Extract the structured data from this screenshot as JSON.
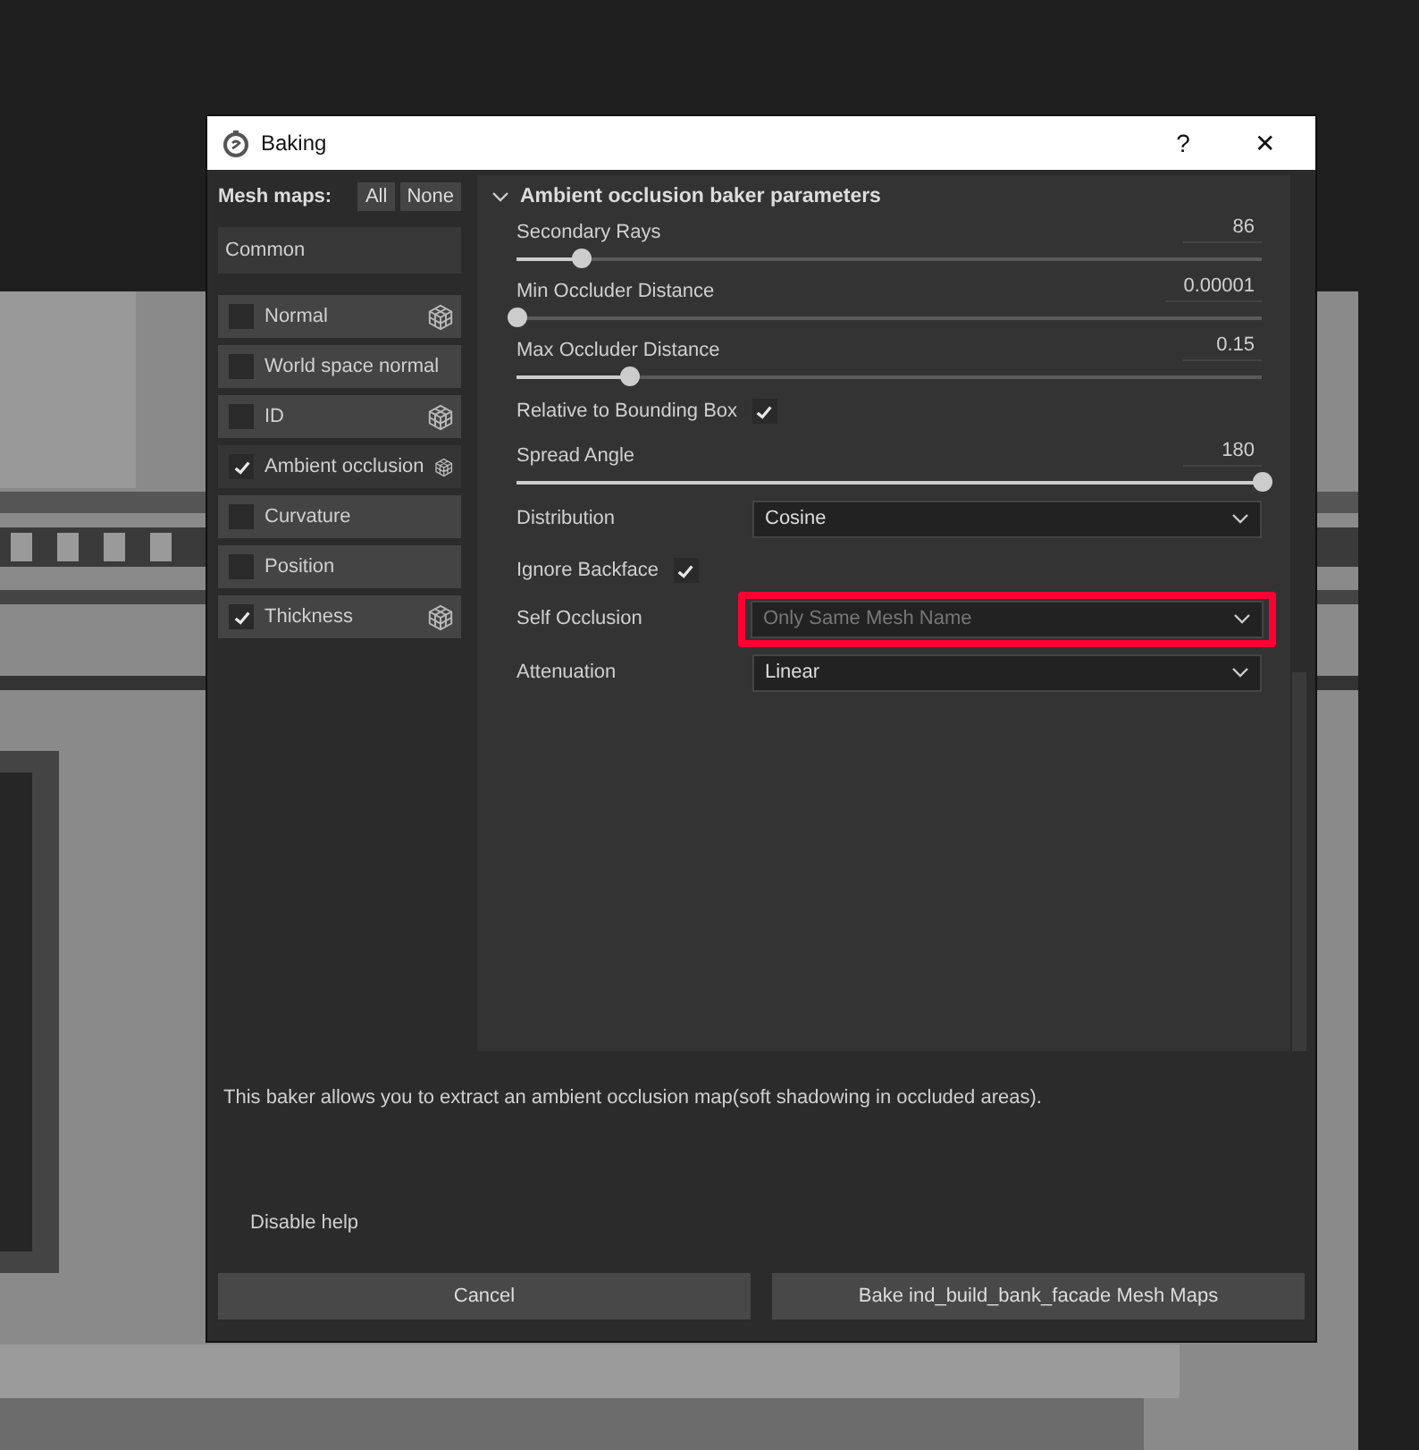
{
  "window": {
    "title": "Baking",
    "help_button": "?",
    "close_button": "✕"
  },
  "mesh_maps": {
    "label": "Mesh maps:",
    "all_button": "All",
    "none_button": "None",
    "common": "Common",
    "items": [
      {
        "label": "Normal",
        "checked": false,
        "selected": false,
        "icon": true
      },
      {
        "label": "World space normal",
        "checked": false,
        "selected": false,
        "icon": false
      },
      {
        "label": "ID",
        "checked": false,
        "selected": false,
        "icon": true
      },
      {
        "label": "Ambient occlusion",
        "checked": true,
        "selected": true,
        "icon": true
      },
      {
        "label": "Curvature",
        "checked": false,
        "selected": false,
        "icon": false
      },
      {
        "label": "Position",
        "checked": false,
        "selected": false,
        "icon": false
      },
      {
        "label": "Thickness",
        "checked": true,
        "selected": false,
        "icon": true
      }
    ]
  },
  "section": {
    "title": "Ambient occlusion baker parameters",
    "expanded": true,
    "params": [
      {
        "kind": "slider",
        "label": "Secondary Rays",
        "value": "86",
        "level": 0.086
      },
      {
        "kind": "slider",
        "label": "Min Occluder Distance",
        "value": "0.00001",
        "level": 0
      },
      {
        "kind": "slider",
        "label": "Max Occluder Distance",
        "value": "0.15",
        "level": 0.15
      },
      {
        "kind": "checkbox",
        "label": "Relative to Bounding Box",
        "checked": true
      },
      {
        "kind": "slider",
        "label": "Spread Angle",
        "value": "180",
        "level": 1
      },
      {
        "kind": "dropdown",
        "label": "Distribution",
        "value": "Cosine",
        "disabled": false,
        "highlighted": false
      },
      {
        "kind": "checkbox",
        "label": "Ignore Backface",
        "checked": true
      },
      {
        "kind": "dropdown",
        "label": "Self Occlusion",
        "value": "Only Same Mesh Name",
        "disabled": true,
        "highlighted": true
      },
      {
        "kind": "dropdown",
        "label": "Attenuation",
        "value": "Linear",
        "disabled": false,
        "highlighted": false
      }
    ]
  },
  "help_text": "This baker allows you to extract an ambient occlusion map(soft shadowing in occluded areas).",
  "disable_help": "Disable help",
  "buttons": [
    "Cancel",
    "Bake ind_build_bank_facade Mesh Maps"
  ]
}
